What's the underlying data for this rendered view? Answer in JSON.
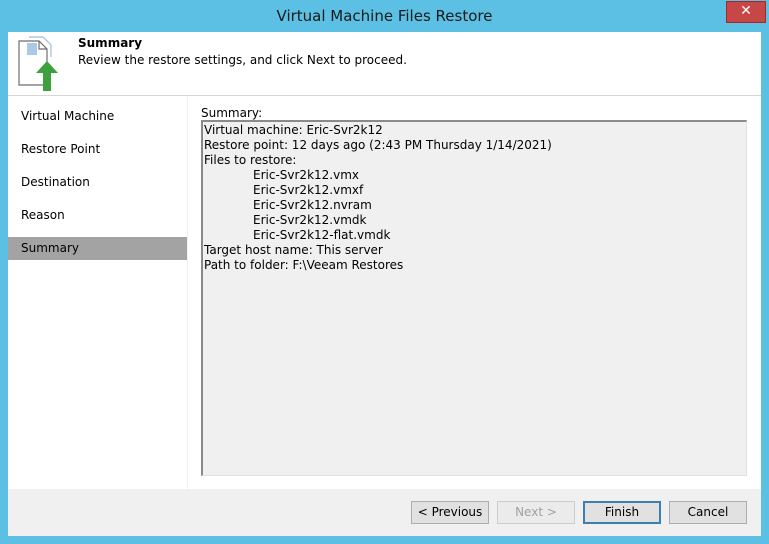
{
  "window": {
    "title": "Virtual Machine Files Restore",
    "close_label": "✕"
  },
  "header": {
    "title": "Summary",
    "subtitle": "Review the restore settings, and click Next to proceed."
  },
  "sidebar": {
    "items": [
      {
        "label": "Virtual Machine"
      },
      {
        "label": "Restore Point"
      },
      {
        "label": "Destination"
      },
      {
        "label": "Reason"
      },
      {
        "label": "Summary",
        "active": true
      }
    ]
  },
  "summary": {
    "label": "Summary:",
    "lines": {
      "vm": "Virtual machine: Eric-Svr2k12",
      "restore_point": "Restore point: 12 days ago (2:43 PM Thursday 1/14/2021)",
      "files_header": "Files to restore:",
      "files": [
        "Eric-Svr2k12.vmx",
        "Eric-Svr2k12.vmxf",
        "Eric-Svr2k12.nvram",
        "Eric-Svr2k12.vmdk",
        "Eric-Svr2k12-flat.vmdk"
      ],
      "target_host": "Target host name: This server",
      "path": "Path to folder: F:\\Veeam Restores"
    }
  },
  "buttons": {
    "previous": "< Previous",
    "next": "Next >",
    "finish": "Finish",
    "cancel": "Cancel"
  },
  "icons": {
    "header_icon": "restore-document-icon",
    "close_icon": "close-icon"
  },
  "colors": {
    "titlebar": "#5bc0e3",
    "close_button": "#c74747",
    "active_nav": "#a3a3a3",
    "arrow_green": "#3ca03c"
  }
}
